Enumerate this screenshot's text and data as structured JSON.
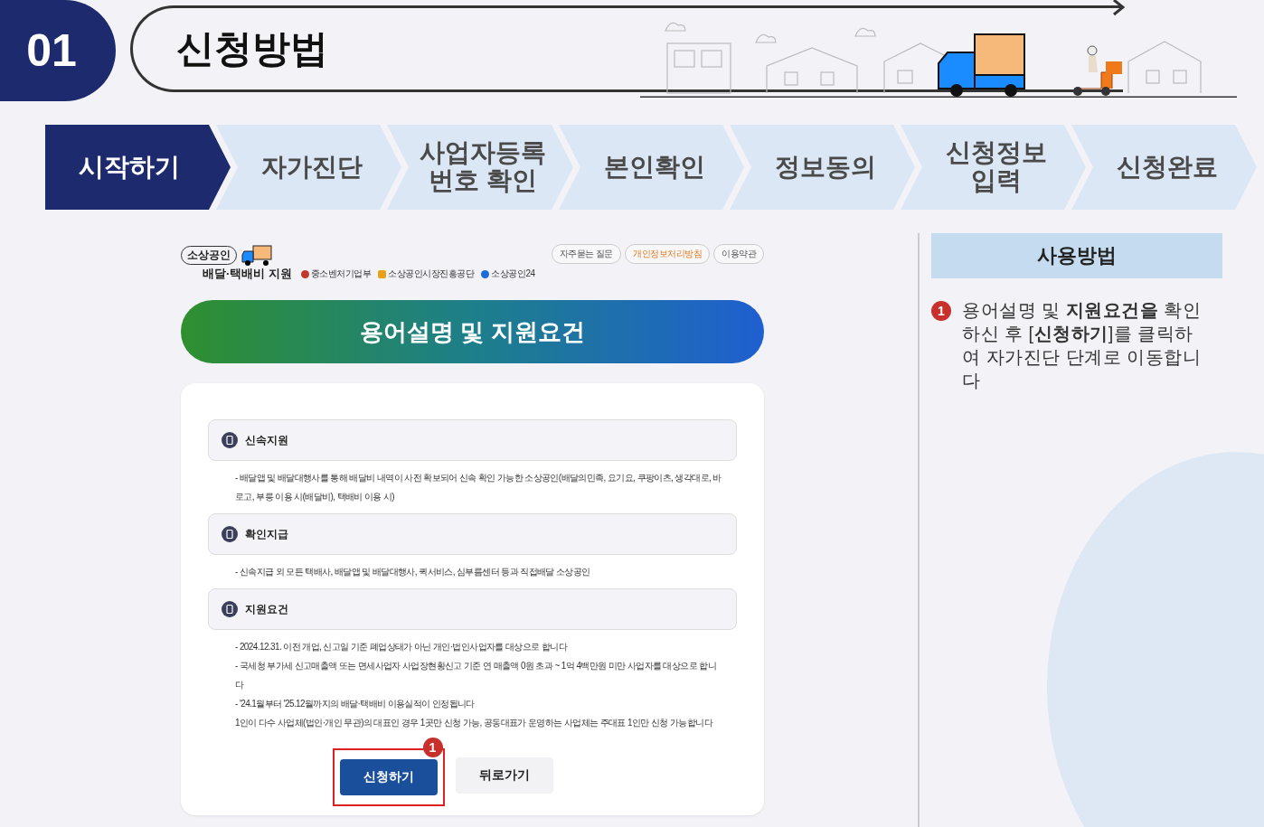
{
  "header": {
    "step_number": "01",
    "title": "신청방법"
  },
  "steps": [
    {
      "label": "시작하기",
      "selected": true
    },
    {
      "label": "자가진단",
      "selected": false
    },
    {
      "label": "사업자등록 번호 확인",
      "selected": false
    },
    {
      "label": "본인확인",
      "selected": false
    },
    {
      "label": "정보동의",
      "selected": false
    },
    {
      "label": "신청정보 입력",
      "selected": false
    },
    {
      "label": "신청완료",
      "selected": false
    }
  ],
  "page": {
    "logo": {
      "badge": "소상공인",
      "title": "배달·택배비 지원"
    },
    "agencies": [
      "중소벤처기업부",
      "소상공인시장진흥공단",
      "소상공인24"
    ],
    "top_links": [
      {
        "label": "자주묻는 질문",
        "kind": "normal"
      },
      {
        "label": "개인정보처리방침",
        "kind": "highlight"
      },
      {
        "label": "이용약관",
        "kind": "normal"
      }
    ],
    "banner": "용어설명 및 지원요건",
    "sections": [
      {
        "title": "신속지원",
        "items": [
          "- 배달앱 및 배달대행사를 통해 배달비 내역이 사전 확보되어 신속 확인 가능한 소상공인(배달의민족, 요기요, 쿠팡이츠, 생각대로, 바로고, 부릉 이용 시(배달비), 택배비 이용 시)"
        ]
      },
      {
        "title": "확인지급",
        "items": [
          "- 신속지급 외 모든 택배사, 배달앱 및 배달대행사, 퀵서비스, 심부름센터 등과 직접배달 소상공인"
        ]
      },
      {
        "title": "지원요건",
        "items": [
          "- 2024.12.31. 이전 개업, 신고일 기준 폐업상태가 아닌 개인·법인사업자를 대상으로 합니다",
          "- 국세청 부가세 신고매출액 또는 면세사업자 사업장현황신고 기준 연 매출액 0원 초과 ~ 1억 4백만원 미만 사업자를 대상으로 합니다",
          "- '24.1월부터 '25.12월까지의 배달·택배비 이용실적이 인정됩니다",
          "1인이 다수 사업체(법인·개인 무관)의 대표인 경우 1곳만 신청 가능, 공동대표가 운영하는 사업체는 주대표 1인만 신청 가능합니다"
        ]
      }
    ],
    "buttons": [
      {
        "label": "신청하기",
        "kind": "primary",
        "callout": "1"
      },
      {
        "label": "뒤로가기",
        "kind": "secondary"
      }
    ]
  },
  "guide": {
    "title": "사용방법",
    "steps": [
      {
        "number": "1",
        "text": "용어설명 및 **지원요건을** 확인하신 후 [**신청하기**]를 클릭하여 자가진단 단계로 이동합니다"
      }
    ]
  }
}
